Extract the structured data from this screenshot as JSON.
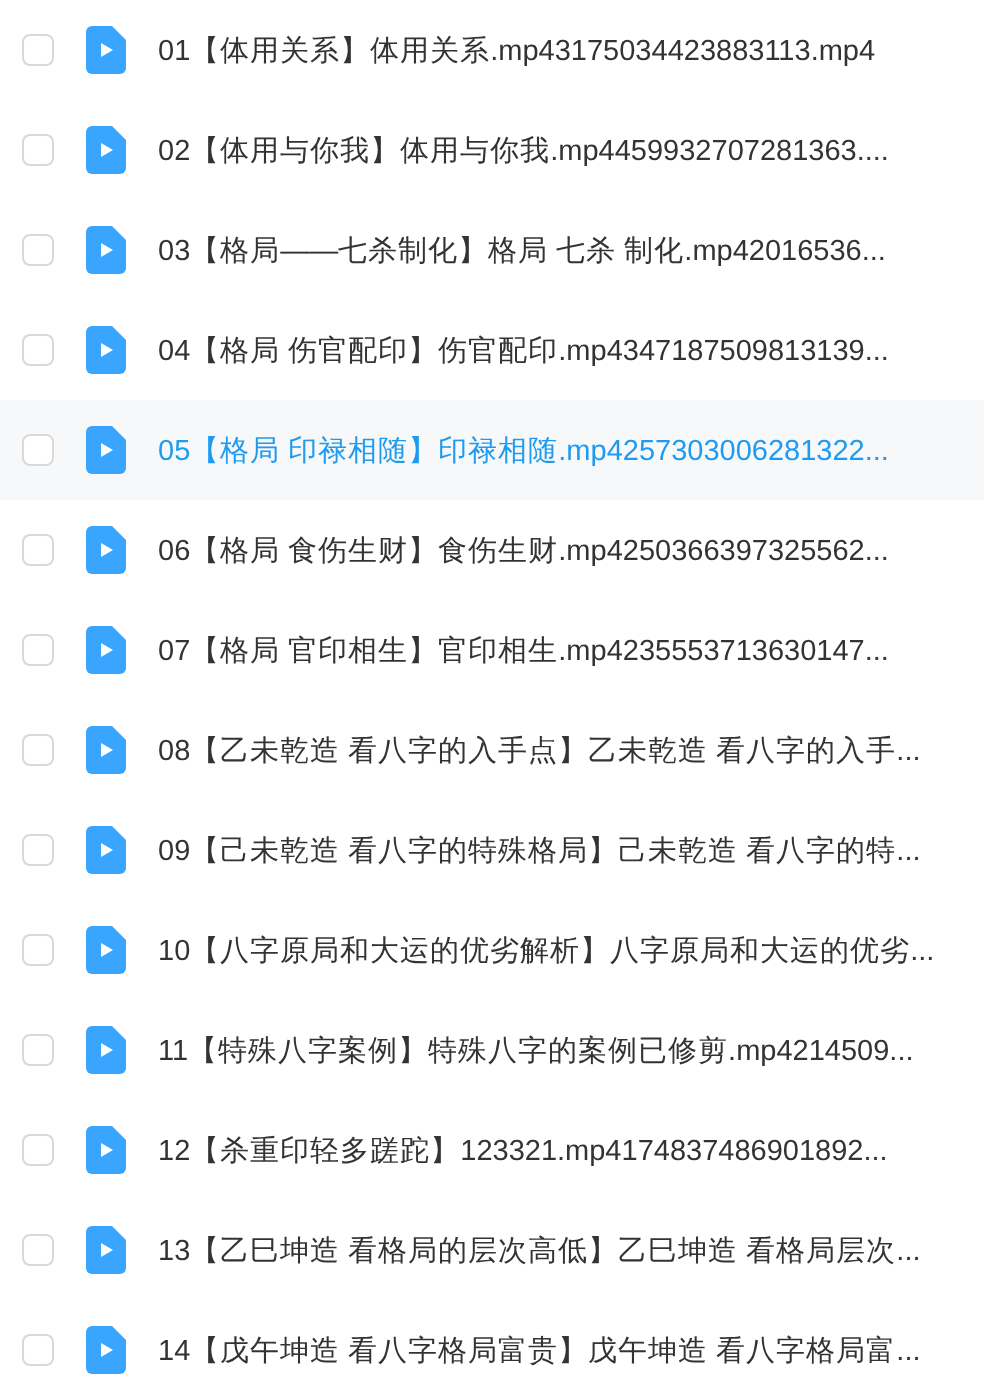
{
  "files": [
    {
      "name": "01【体用关系】体用关系.mp43175034423883113.mp4",
      "checked": false,
      "selected": false
    },
    {
      "name": "02【体用与你我】体用与你我.mp4459932707281363....",
      "checked": false,
      "selected": false
    },
    {
      "name": "03【格局——七杀制化】格局  七杀 制化.mp42016536...",
      "checked": false,
      "selected": false
    },
    {
      "name": "04【格局  伤官配印】伤官配印.mp4347187509813139...",
      "checked": false,
      "selected": false
    },
    {
      "name": "05【格局  印禄相随】印禄相随.mp4257303006281322...",
      "checked": false,
      "selected": true
    },
    {
      "name": "06【格局  食伤生财】食伤生财.mp4250366397325562...",
      "checked": false,
      "selected": false
    },
    {
      "name": "07【格局  官印相生】官印相生.mp4235553713630147...",
      "checked": false,
      "selected": false
    },
    {
      "name": "08【乙未乾造  看八字的入手点】乙未乾造  看八字的入手...",
      "checked": false,
      "selected": false
    },
    {
      "name": "09【己未乾造  看八字的特殊格局】己未乾造 看八字的特...",
      "checked": false,
      "selected": false
    },
    {
      "name": "10【八字原局和大运的优劣解析】八字原局和大运的优劣...",
      "checked": false,
      "selected": false
    },
    {
      "name": "11【特殊八字案例】特殊八字的案例已修剪.mp4214509...",
      "checked": false,
      "selected": false
    },
    {
      "name": "12【杀重印轻多蹉跎】123321.mp4174837486901892...",
      "checked": false,
      "selected": false
    },
    {
      "name": "13【乙巳坤造  看格局的层次高低】乙巳坤造 看格局层次...",
      "checked": false,
      "selected": false
    },
    {
      "name": "14【戊午坤造  看八字格局富贵】戊午坤造 看八字格局富...",
      "checked": false,
      "selected": false
    }
  ]
}
